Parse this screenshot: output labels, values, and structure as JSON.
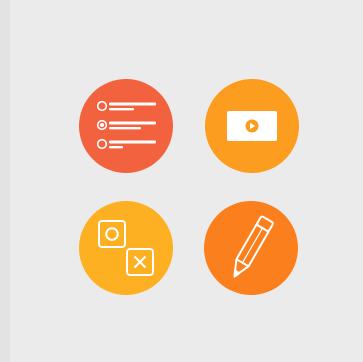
{
  "tiles": [
    {
      "icon": "multiple-choice-list-icon",
      "color": "#f2623f"
    },
    {
      "icon": "video-play-icon",
      "color": "#fc9d20"
    },
    {
      "icon": "tic-tac-toe-icon",
      "color": "#fdb122"
    },
    {
      "icon": "pencil-icon",
      "color": "#fb7f1c"
    }
  ]
}
